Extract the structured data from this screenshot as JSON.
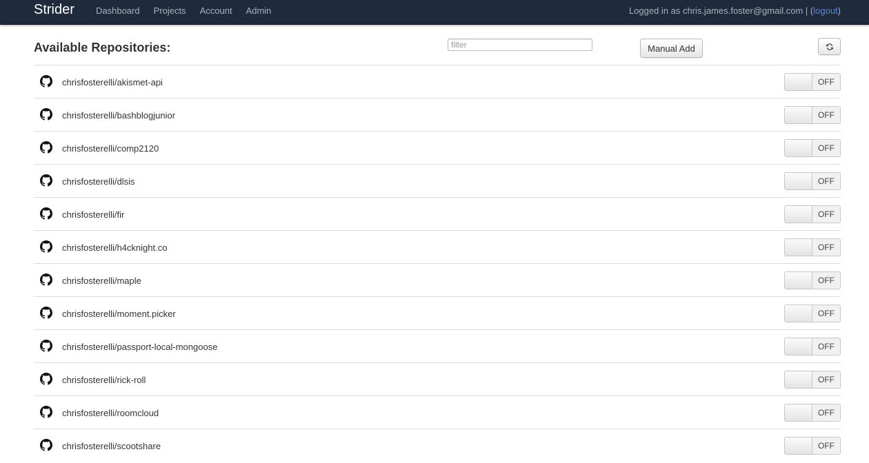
{
  "navbar": {
    "brand": "Strider",
    "links": [
      "Dashboard",
      "Projects",
      "Account",
      "Admin"
    ],
    "logged_in_text": "Logged in as chris.james.foster@gmail.com | (",
    "logout_label": "logout",
    "logout_close": ")"
  },
  "header": {
    "title": "Available Repositories:",
    "filter_placeholder": "filter",
    "manual_add_label": "Manual Add",
    "refresh_icon": "refresh-icon"
  },
  "repos": {
    "icon": "github-icon",
    "items": [
      {
        "name": "chrisfosterelli/akismet-api",
        "toggle": "OFF"
      },
      {
        "name": "chrisfosterelli/bashblogjunior",
        "toggle": "OFF"
      },
      {
        "name": "chrisfosterelli/comp2120",
        "toggle": "OFF"
      },
      {
        "name": "chrisfosterelli/dlsis",
        "toggle": "OFF"
      },
      {
        "name": "chrisfosterelli/fir",
        "toggle": "OFF"
      },
      {
        "name": "chrisfosterelli/h4cknight.co",
        "toggle": "OFF"
      },
      {
        "name": "chrisfosterelli/maple",
        "toggle": "OFF"
      },
      {
        "name": "chrisfosterelli/moment.picker",
        "toggle": "OFF"
      },
      {
        "name": "chrisfosterelli/passport-local-mongoose",
        "toggle": "OFF"
      },
      {
        "name": "chrisfosterelli/rick-roll",
        "toggle": "OFF"
      },
      {
        "name": "chrisfosterelli/roomcloud",
        "toggle": "OFF"
      },
      {
        "name": "chrisfosterelli/scootshare",
        "toggle": "OFF"
      }
    ]
  },
  "colors": {
    "navbar_bg": "#1f2a3d",
    "nav_text": "#a9b1bd",
    "link_blue": "#5f87c7"
  }
}
